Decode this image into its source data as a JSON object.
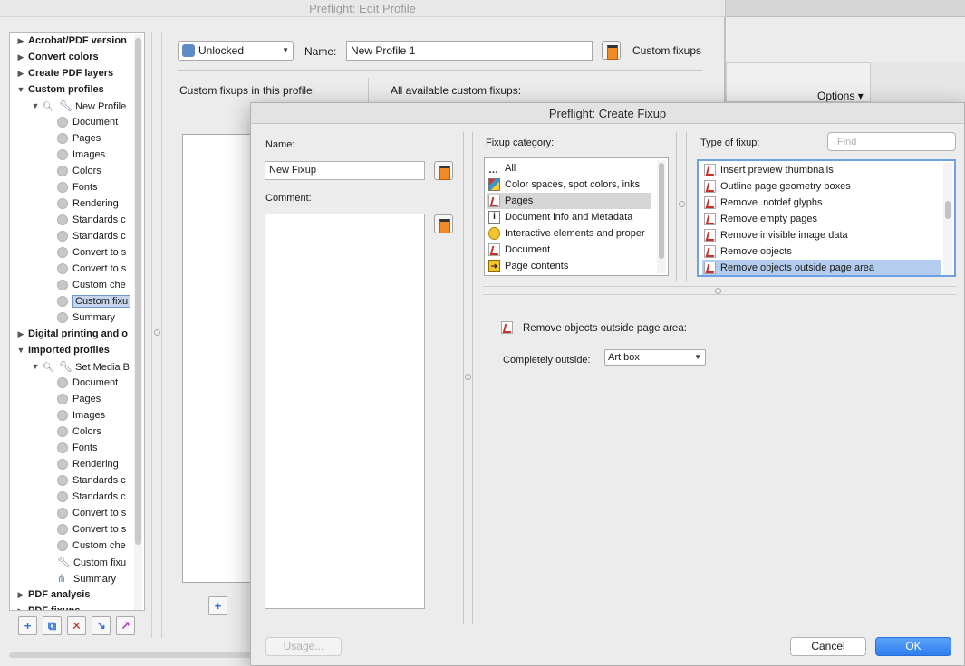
{
  "edit_profile": {
    "title": "Preflight: Edit Profile",
    "lock_select": "Unlocked",
    "name_label": "Name:",
    "name_value": "New Profile 1",
    "custom_fixups_title": "Custom fixups",
    "in_profile_label": "Custom fixups in this profile:",
    "available_label": "All available custom fixups:",
    "tree": [
      {
        "label": "Acrobat/PDF version",
        "level": 0,
        "bold": true,
        "disclosure": "closed"
      },
      {
        "label": "Convert colors",
        "level": 0,
        "bold": true,
        "disclosure": "closed"
      },
      {
        "label": "Create PDF layers",
        "level": 0,
        "bold": true,
        "disclosure": "closed"
      },
      {
        "label": "Custom profiles",
        "level": 0,
        "bold": true,
        "disclosure": "open"
      },
      {
        "label": "New Profile",
        "level": 1,
        "icon": "wrench",
        "disclosure": "open"
      },
      {
        "label": "Document",
        "level": 2,
        "icon": "dot"
      },
      {
        "label": "Pages",
        "level": 2,
        "icon": "dot"
      },
      {
        "label": "Images",
        "level": 2,
        "icon": "dot"
      },
      {
        "label": "Colors",
        "level": 2,
        "icon": "dot"
      },
      {
        "label": "Fonts",
        "level": 2,
        "icon": "dot"
      },
      {
        "label": "Rendering",
        "level": 2,
        "icon": "dot"
      },
      {
        "label": "Standards c",
        "level": 2,
        "icon": "dot"
      },
      {
        "label": "Standards c",
        "level": 2,
        "icon": "dot"
      },
      {
        "label": "Convert to s",
        "level": 2,
        "icon": "dot"
      },
      {
        "label": "Convert to s",
        "level": 2,
        "icon": "dot"
      },
      {
        "label": "Custom che",
        "level": 2,
        "icon": "dot"
      },
      {
        "label": "Custom fixu",
        "level": 2,
        "icon": "dot",
        "selected": true
      },
      {
        "label": "Summary",
        "level": 2,
        "icon": "dot"
      },
      {
        "label": "Digital printing and o",
        "level": 0,
        "bold": true,
        "disclosure": "closed"
      },
      {
        "label": "Imported profiles",
        "level": 0,
        "bold": true,
        "disclosure": "open"
      },
      {
        "label": "Set Media B",
        "level": 1,
        "icon": "wrench",
        "disclosure": "open"
      },
      {
        "label": "Document",
        "level": 2,
        "icon": "dot"
      },
      {
        "label": "Pages",
        "level": 2,
        "icon": "dot"
      },
      {
        "label": "Images",
        "level": 2,
        "icon": "dot"
      },
      {
        "label": "Colors",
        "level": 2,
        "icon": "dot"
      },
      {
        "label": "Fonts",
        "level": 2,
        "icon": "dot"
      },
      {
        "label": "Rendering",
        "level": 2,
        "icon": "dot"
      },
      {
        "label": "Standards c",
        "level": 2,
        "icon": "dot"
      },
      {
        "label": "Standards c",
        "level": 2,
        "icon": "dot"
      },
      {
        "label": "Convert to s",
        "level": 2,
        "icon": "dot"
      },
      {
        "label": "Convert to s",
        "level": 2,
        "icon": "dot"
      },
      {
        "label": "Custom che",
        "level": 2,
        "icon": "dot"
      },
      {
        "label": "Custom fixu",
        "level": 2,
        "icon": "wrench"
      },
      {
        "label": "Summary",
        "level": 2,
        "icon": "tree"
      },
      {
        "label": "PDF analysis",
        "level": 0,
        "bold": true,
        "disclosure": "closed"
      },
      {
        "label": "PDF fixups",
        "level": 0,
        "bold": true,
        "disclosure": "closed"
      }
    ]
  },
  "background_window": {
    "options_label": "Options"
  },
  "dialog": {
    "title": "Preflight: Create Fixup",
    "name_label": "Name:",
    "name_value": "New Fixup",
    "comment_label": "Comment:",
    "category_label": "Fixup category:",
    "categories": [
      {
        "label": "All",
        "icon": "dots"
      },
      {
        "label": "Color spaces, spot colors, inks",
        "icon": "color"
      },
      {
        "label": "Pages",
        "icon": "pdf",
        "selected": true
      },
      {
        "label": "Document info and Metadata",
        "icon": "info"
      },
      {
        "label": "Interactive elements and proper",
        "icon": "bubble"
      },
      {
        "label": "Document",
        "icon": "pdf"
      },
      {
        "label": "Page contents",
        "icon": "arrow"
      }
    ],
    "type_label": "Type of fixup:",
    "find_placeholder": "Find",
    "types": [
      {
        "label": "Insert preview thumbnails"
      },
      {
        "label": "Outline page geometry boxes"
      },
      {
        "label": "Remove .notdef glyphs"
      },
      {
        "label": "Remove empty pages"
      },
      {
        "label": "Remove invisible image data"
      },
      {
        "label": "Remove objects"
      },
      {
        "label": "Remove objects outside page area",
        "selected": true
      }
    ],
    "detail_title": "Remove objects outside page area:",
    "completely_outside_label": "Completely outside:",
    "completely_outside_value": "Art box",
    "usage_button": "Usage...",
    "cancel_button": "Cancel",
    "ok_button": "OK"
  }
}
